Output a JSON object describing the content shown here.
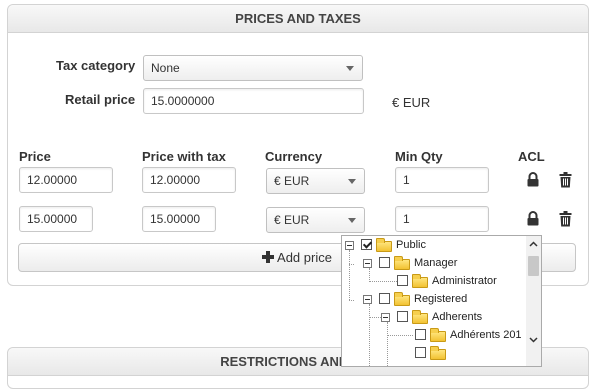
{
  "prices_panel": {
    "title": "PRICES AND TAXES",
    "tax_category_label": "Tax category",
    "tax_category_value": "None",
    "retail_price_label": "Retail price",
    "retail_price_value": "15.0000000",
    "retail_currency": "€ EUR",
    "columns": {
      "price": "Price",
      "price_with_tax": "Price with tax",
      "currency": "Currency",
      "min_qty": "Min Qty",
      "acl": "ACL"
    },
    "rows": [
      {
        "price": "12.00000",
        "price_with_tax": "12.00000",
        "currency": "€ EUR",
        "min_qty": "1"
      },
      {
        "price": "15.00000",
        "price_with_tax": "15.00000",
        "currency": "€ EUR",
        "min_qty": "1"
      }
    ],
    "add_price_label": "Add price",
    "icons": {
      "add": "plus-icon",
      "lock": "lock-icon",
      "delete": "trash-icon"
    }
  },
  "acl_tree": {
    "nodes": [
      {
        "label": "Public",
        "checked": true,
        "expanded": true
      },
      {
        "label": "Manager",
        "checked": false,
        "expanded": true
      },
      {
        "label": "Administrator",
        "checked": false
      },
      {
        "label": "Registered",
        "checked": false,
        "expanded": true
      },
      {
        "label": "Adherents",
        "checked": false,
        "expanded": true
      },
      {
        "label": "Adhérents 201",
        "checked": false
      }
    ]
  },
  "restrictions_panel": {
    "title": "RESTRICTIONS AND DIM"
  }
}
